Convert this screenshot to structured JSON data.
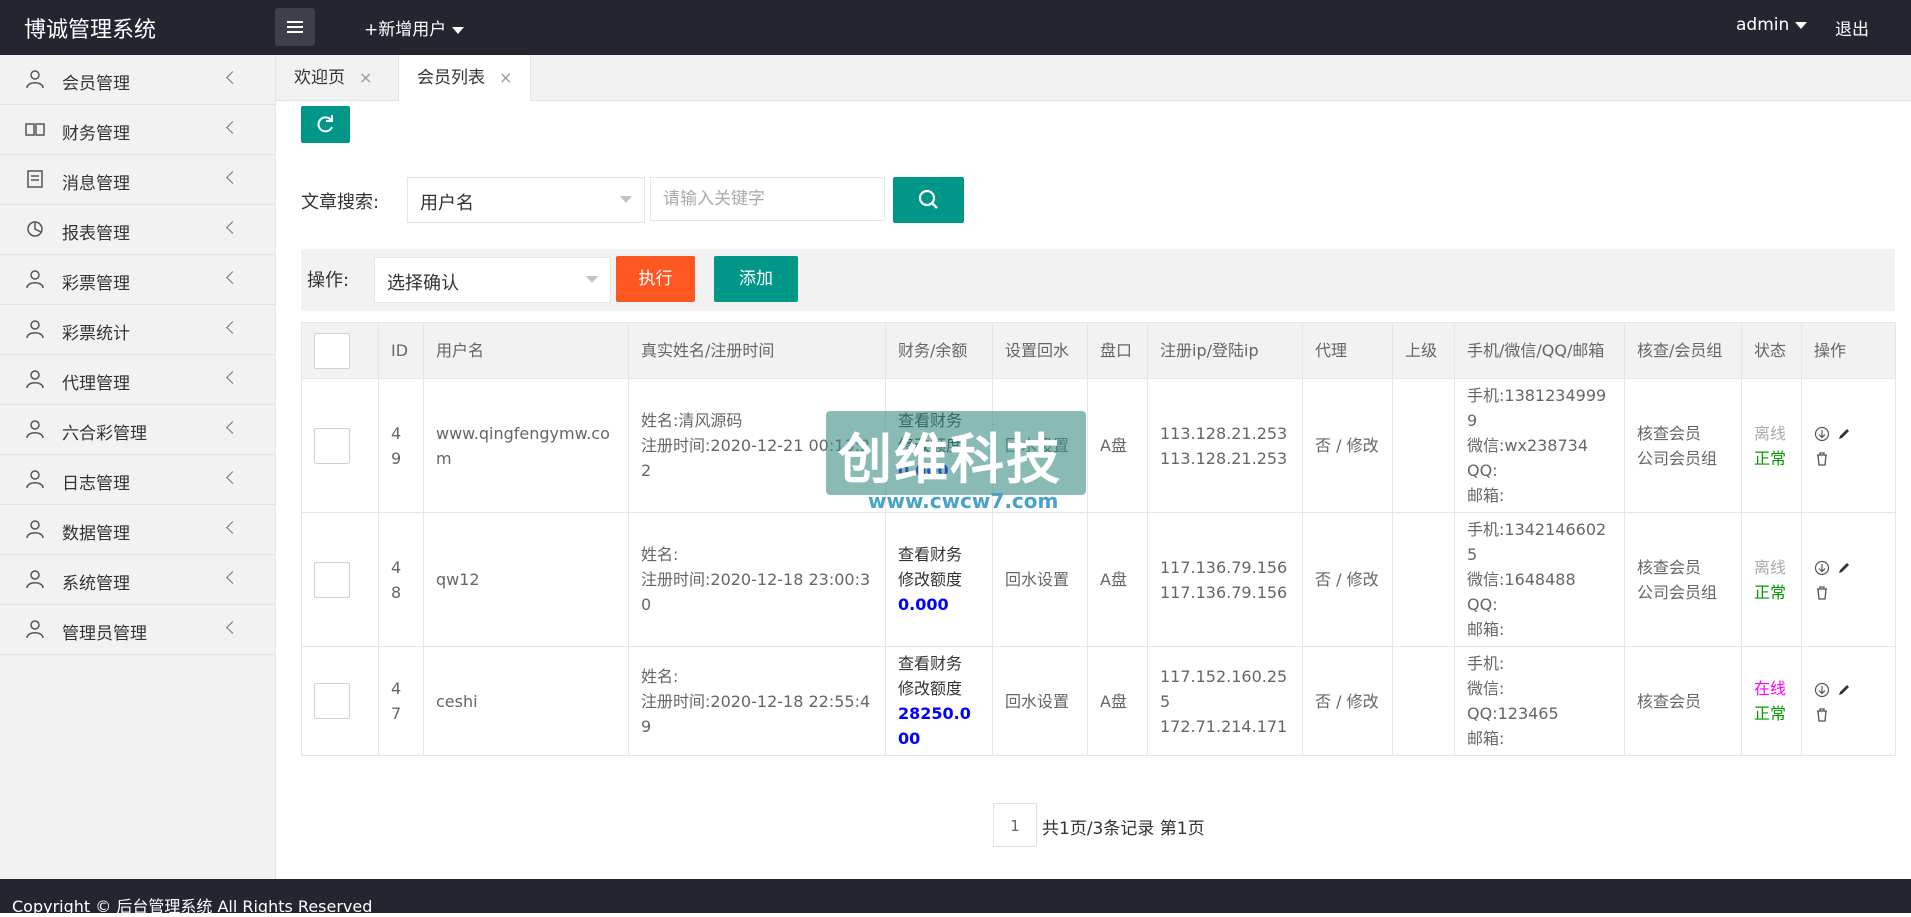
{
  "header": {
    "title": "博诚管理系统",
    "add_user": "+新增用户",
    "admin": "admin",
    "logout": "退出"
  },
  "sidebar": {
    "items": [
      {
        "label": "会员管理",
        "icon": "user-icon"
      },
      {
        "label": "财务管理",
        "icon": "book-icon"
      },
      {
        "label": "消息管理",
        "icon": "message-icon"
      },
      {
        "label": "报表管理",
        "icon": "report-icon"
      },
      {
        "label": "彩票管理",
        "icon": "user-icon"
      },
      {
        "label": "彩票统计",
        "icon": "user-icon"
      },
      {
        "label": "代理管理",
        "icon": "user-icon"
      },
      {
        "label": "六合彩管理",
        "icon": "user-icon"
      },
      {
        "label": "日志管理",
        "icon": "user-icon"
      },
      {
        "label": "数据管理",
        "icon": "user-icon"
      },
      {
        "label": "系统管理",
        "icon": "user-icon"
      },
      {
        "label": "管理员管理",
        "icon": "user-icon"
      }
    ]
  },
  "tabs": [
    {
      "label": "欢迎页",
      "close": "×"
    },
    {
      "label": "会员列表",
      "close": "×"
    }
  ],
  "search": {
    "label": "文章搜索:",
    "field_selected": "用户名",
    "placeholder": "请输入关键字"
  },
  "operation": {
    "label": "操作:",
    "select_selected": "选择确认",
    "execute": "执行",
    "add": "添加"
  },
  "table": {
    "columns": [
      "",
      "ID",
      "用户名",
      "真实姓名/注册时间",
      "财务/余额",
      "设置回水",
      "盘口",
      "注册ip/登陆ip",
      "代理",
      "上级",
      "手机/微信/QQ/邮箱",
      "核查/会员组",
      "状态",
      "操作"
    ],
    "rows": [
      {
        "id": "49",
        "username": "www.qingfengymw.com",
        "realname": "姓名:清风源码",
        "regtime": "注册时间:2020-12-21 00:13:22",
        "finance_view": "查看财务",
        "finance_edit": "修改额度",
        "balance": "0.000",
        "rebate": "回水设置",
        "pankou": "A盘",
        "reg_ip": "113.128.21.253",
        "login_ip": "113.128.21.253",
        "agent": "否 / 修改",
        "superior": "",
        "phone": "手机:13812349999",
        "wechat": "微信:wx238734",
        "qq": "QQ:",
        "email": "邮箱:",
        "check": "核查会员",
        "group": "公司会员组",
        "online": "离线",
        "status": "正常",
        "online_color": "#aaaaaa"
      },
      {
        "id": "48",
        "username": "qw12",
        "realname": "姓名:",
        "regtime": "注册时间:2020-12-18 23:00:30",
        "finance_view": "查看财务",
        "finance_edit": "修改额度",
        "balance": "0.000",
        "rebate": "回水设置",
        "pankou": "A盘",
        "reg_ip": "117.136.79.156",
        "login_ip": "117.136.79.156",
        "agent": "否 / 修改",
        "superior": "",
        "phone": "手机:13421466025",
        "wechat": "微信:1648488",
        "qq": "QQ:",
        "email": "邮箱:",
        "check": "核查会员",
        "group": "公司会员组",
        "online": "离线",
        "status": "正常",
        "online_color": "#aaaaaa"
      },
      {
        "id": "47",
        "username": "ceshi",
        "realname": "姓名:",
        "regtime": "注册时间:2020-12-18 22:55:49",
        "finance_view": "查看财务",
        "finance_edit": "修改额度",
        "balance": "28250.000",
        "rebate": "回水设置",
        "pankou": "A盘",
        "reg_ip": "117.152.160.255",
        "login_ip": "172.71.214.171",
        "agent": "否 / 修改",
        "superior": "",
        "phone": "手机:",
        "wechat": "微信:",
        "qq": "QQ:123465",
        "email": "邮箱:",
        "check": "核查会员",
        "group": "",
        "online": "在线",
        "status": "正常",
        "online_color": "#ff00ff"
      }
    ]
  },
  "pagination": {
    "current": "1",
    "summary": "共1页/3条记录 第1页"
  },
  "footer": {
    "copyright": "Copyright © 后台管理系统 All Rights Reserved"
  },
  "watermark": {
    "text": "创维科技",
    "url": "www.cwcw7.com"
  },
  "colors": {
    "primary": "#009688",
    "danger": "#ff5722",
    "header_bg": "#23262e",
    "balance": "#0000ff",
    "status_normal": "#009900"
  }
}
